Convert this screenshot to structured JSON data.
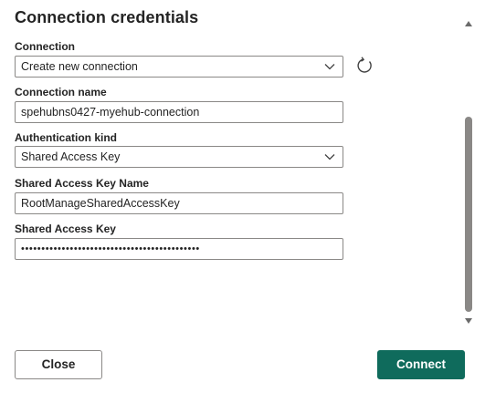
{
  "dialog": {
    "title": "Connection credentials"
  },
  "fields": {
    "connection": {
      "label": "Connection",
      "value": "Create new connection"
    },
    "connection_name": {
      "label": "Connection name",
      "value": "spehubns0427-myehub-connection"
    },
    "auth_kind": {
      "label": "Authentication kind",
      "value": "Shared Access Key"
    },
    "sas_key_name": {
      "label": "Shared Access Key Name",
      "value": "RootManageSharedAccessKey"
    },
    "sas_key": {
      "label": "Shared Access Key",
      "value": "••••••••••••••••••••••••••••••••••••••••••••"
    }
  },
  "icons": {
    "refresh": "refresh-icon",
    "chevron": "chevron-down-icon"
  },
  "buttons": {
    "close": "Close",
    "connect": "Connect"
  },
  "colors": {
    "primary": "#0f6b5c",
    "border": "#8a8886",
    "text": "#242424"
  }
}
